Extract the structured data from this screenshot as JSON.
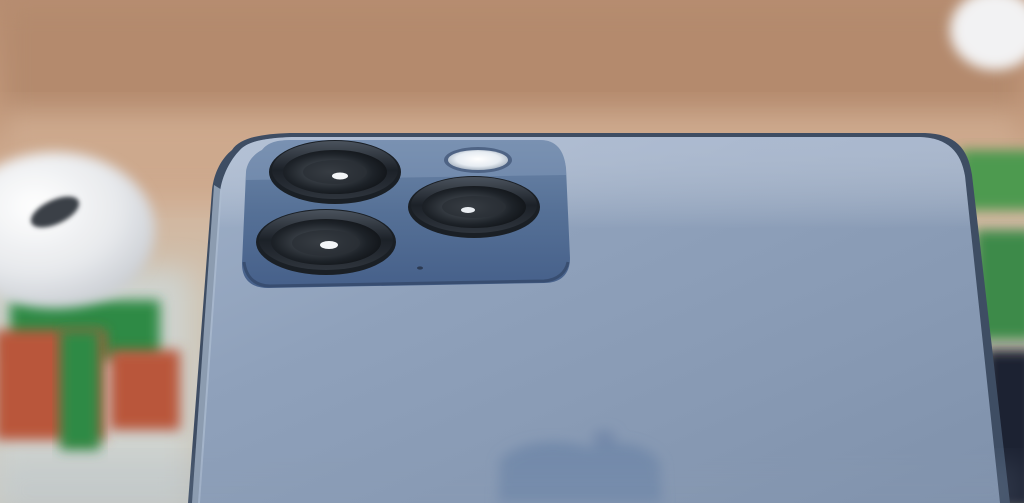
{
  "photo": {
    "subject": "phone-rear-camera-closeup",
    "colors": {
      "table": "#c49a7c",
      "phone_body": "#8fa2bd",
      "camera_module": "#5b7396",
      "lens_ring": "#1f252d",
      "frame_edge": "#3e4d63",
      "logo": "#6f86a8",
      "earbuds_case": "#e9ebee",
      "background_green": "#3c8a4a",
      "background_red": "#b9563a"
    },
    "lenses": [
      "wide-lens",
      "ultra-wide-lens",
      "telephoto-lens"
    ],
    "accessories": [
      "flash",
      "microphone"
    ]
  }
}
